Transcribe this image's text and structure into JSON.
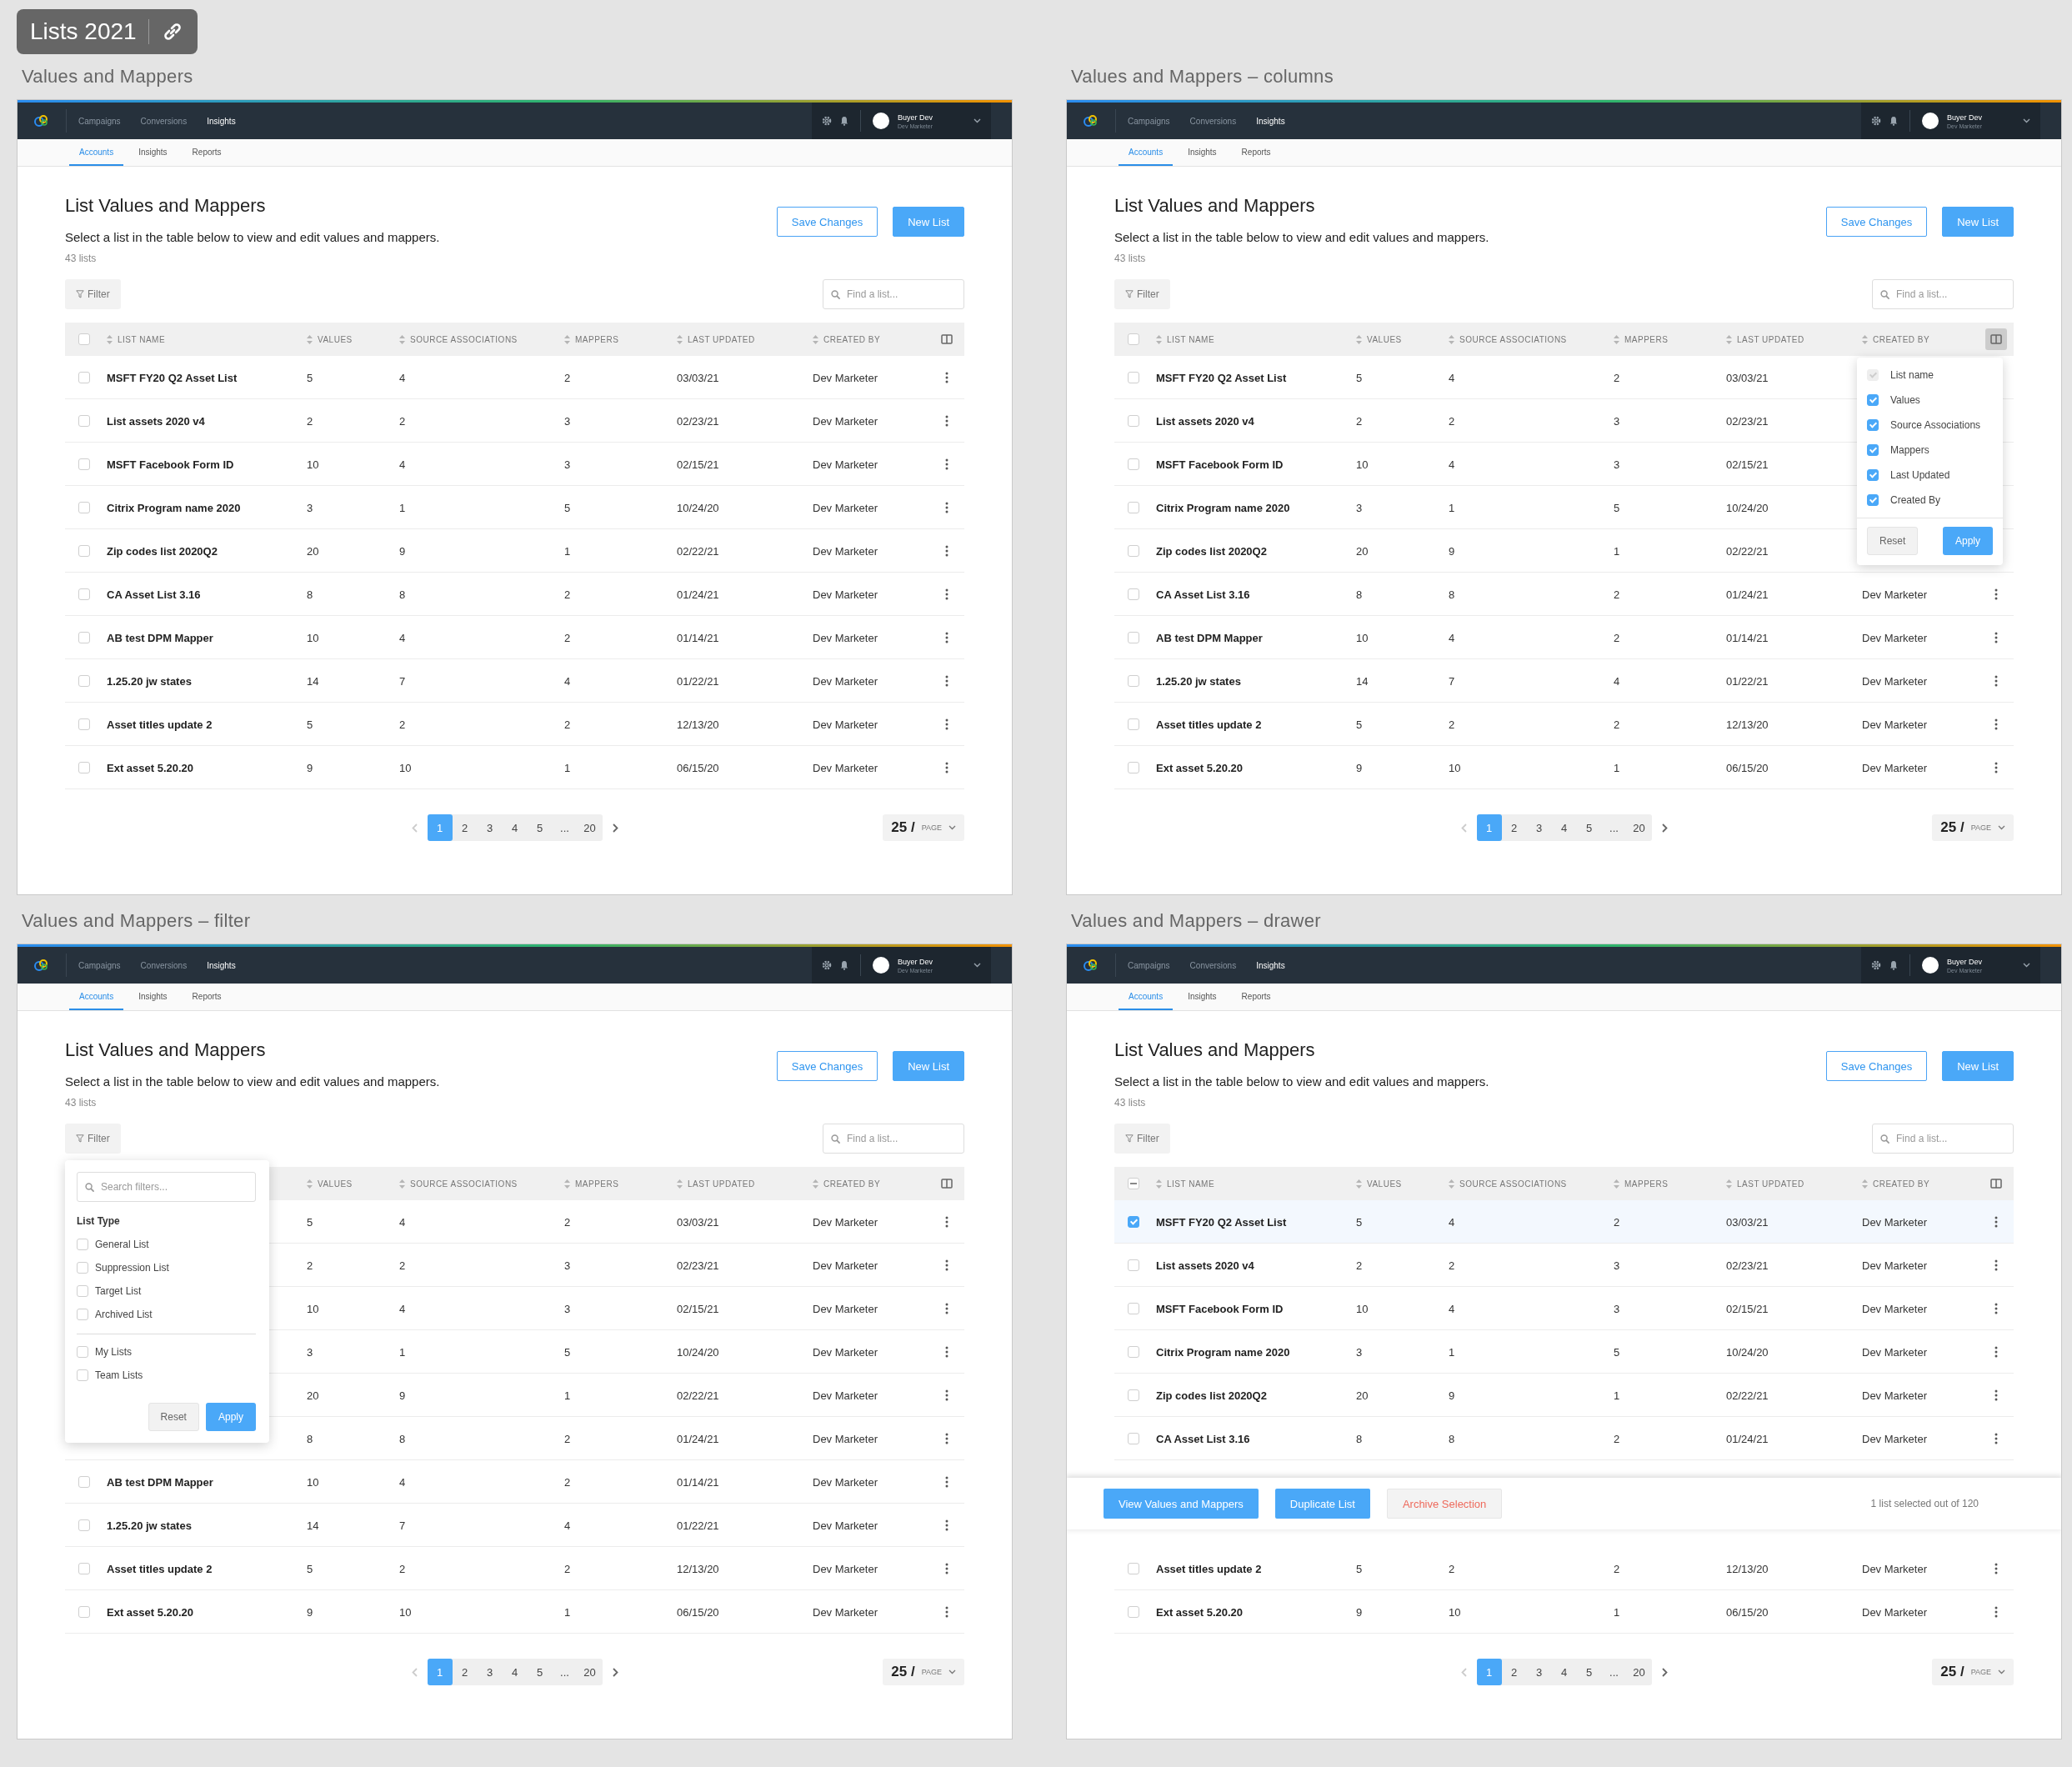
{
  "badge": {
    "title": "Lists 2021"
  },
  "artboards": [
    {
      "label": "Values and Mappers",
      "nav": {
        "items": [
          {
            "label": "Campaigns",
            "selected": false
          },
          {
            "label": "Conversions",
            "selected": false
          },
          {
            "label": "Insights",
            "selected": true
          }
        ],
        "user": {
          "name": "Buyer Dev",
          "role": "Dev Marketer"
        }
      },
      "tabs": [
        {
          "label": "Accounts",
          "selected": true
        },
        {
          "label": "Insights",
          "selected": false
        },
        {
          "label": "Reports",
          "selected": false
        }
      ],
      "page": {
        "title": "List Values and Mappers",
        "subtitle": "Select a list in the table below to view and edit values and mappers.",
        "count": "43 lists",
        "save_button": "Save Changes",
        "new_button": "New List",
        "filter_button": "Filter",
        "search_placeholder": "Find a list..."
      },
      "table": {
        "header_checkbox": {
          "indeterminate": false
        },
        "column_toggle_active": false,
        "columns": [
          "LIST NAME",
          "VALUES",
          "SOURCE ASSOCIATIONS",
          "MAPPERS",
          "LAST UPDATED",
          "CREATED BY"
        ],
        "rows": [
          {
            "selected": false,
            "name": "MSFT FY20 Q2 Asset List",
            "values": "5",
            "sources": "4",
            "mappers": "2",
            "updated": "03/03/21",
            "created_by": "Dev Marketer"
          },
          {
            "selected": false,
            "name": "List assets 2020 v4",
            "values": "2",
            "sources": "2",
            "mappers": "3",
            "updated": "02/23/21",
            "created_by": "Dev Marketer"
          },
          {
            "selected": false,
            "name": "MSFT Facebook Form ID",
            "values": "10",
            "sources": "4",
            "mappers": "3",
            "updated": "02/15/21",
            "created_by": "Dev Marketer"
          },
          {
            "selected": false,
            "name": "Citrix Program name 2020",
            "values": "3",
            "sources": "1",
            "mappers": "5",
            "updated": "10/24/20",
            "created_by": "Dev Marketer"
          },
          {
            "selected": false,
            "name": "Zip codes list 2020Q2",
            "values": "20",
            "sources": "9",
            "mappers": "1",
            "updated": "02/22/21",
            "created_by": "Dev Marketer"
          },
          {
            "selected": false,
            "name": "CA Asset List 3.16",
            "values": "8",
            "sources": "8",
            "mappers": "2",
            "updated": "01/24/21",
            "created_by": "Dev Marketer"
          },
          {
            "selected": false,
            "name": "AB test DPM Mapper",
            "values": "10",
            "sources": "4",
            "mappers": "2",
            "updated": "01/14/21",
            "created_by": "Dev Marketer"
          },
          {
            "selected": false,
            "name": "1.25.20 jw states",
            "values": "14",
            "sources": "7",
            "mappers": "4",
            "updated": "01/22/21",
            "created_by": "Dev Marketer"
          },
          {
            "selected": false,
            "name": "Asset titles update 2",
            "values": "5",
            "sources": "2",
            "mappers": "2",
            "updated": "12/13/20",
            "created_by": "Dev Marketer"
          },
          {
            "selected": false,
            "name": "Ext asset 5.20.20",
            "values": "9",
            "sources": "10",
            "mappers": "1",
            "updated": "06/15/20",
            "created_by": "Dev Marketer"
          }
        ]
      },
      "pagination": {
        "pages": [
          {
            "label": "1",
            "selected": true
          },
          {
            "label": "2",
            "selected": false
          },
          {
            "label": "3",
            "selected": false
          },
          {
            "label": "4",
            "selected": false
          },
          {
            "label": "5",
            "selected": false
          },
          {
            "label": "...",
            "selected": false
          },
          {
            "label": "20",
            "selected": false
          }
        ],
        "per_page": "25 /",
        "per_page_unit": "PAGE"
      }
    },
    {
      "label": "Values and Mappers – columns",
      "nav": {
        "items": [
          {
            "label": "Campaigns",
            "selected": false
          },
          {
            "label": "Conversions",
            "selected": false
          },
          {
            "label": "Insights",
            "selected": true
          }
        ],
        "user": {
          "name": "Buyer Dev",
          "role": "Dev Marketer"
        }
      },
      "tabs": [
        {
          "label": "Accounts",
          "selected": true
        },
        {
          "label": "Insights",
          "selected": false
        },
        {
          "label": "Reports",
          "selected": false
        }
      ],
      "page": {
        "title": "List Values and Mappers",
        "subtitle": "Select a list in the table below to view and edit values and mappers.",
        "count": "43 lists",
        "save_button": "Save Changes",
        "new_button": "New List",
        "filter_button": "Filter",
        "search_placeholder": "Find a list..."
      },
      "table": {
        "header_checkbox": {
          "indeterminate": false
        },
        "column_toggle_active": true,
        "columns": [
          "LIST NAME",
          "VALUES",
          "SOURCE ASSOCIATIONS",
          "MAPPERS",
          "LAST UPDATED",
          "CREATED BY"
        ],
        "rows": [
          {
            "selected": false,
            "name": "MSFT FY20 Q2 Asset List",
            "values": "5",
            "sources": "4",
            "mappers": "2",
            "updated": "03/03/21"
          },
          {
            "selected": false,
            "name": "List assets 2020 v4",
            "values": "2",
            "sources": "2",
            "mappers": "3",
            "updated": "02/23/21"
          },
          {
            "selected": false,
            "name": "MSFT Facebook Form ID",
            "values": "10",
            "sources": "4",
            "mappers": "3",
            "updated": "02/15/21"
          },
          {
            "selected": false,
            "name": "Citrix Program name 2020",
            "values": "3",
            "sources": "1",
            "mappers": "5",
            "updated": "10/24/20"
          },
          {
            "selected": false,
            "name": "Zip codes list 2020Q2",
            "values": "20",
            "sources": "9",
            "mappers": "1",
            "updated": "02/22/21"
          },
          {
            "selected": false,
            "name": "CA Asset List 3.16",
            "values": "8",
            "sources": "8",
            "mappers": "2",
            "updated": "01/24/21",
            "created_by": "Dev Marketer"
          },
          {
            "selected": false,
            "name": "AB test DPM Mapper",
            "values": "10",
            "sources": "4",
            "mappers": "2",
            "updated": "01/14/21",
            "created_by": "Dev Marketer"
          },
          {
            "selected": false,
            "name": "1.25.20 jw states",
            "values": "14",
            "sources": "7",
            "mappers": "4",
            "updated": "01/22/21",
            "created_by": "Dev Marketer"
          },
          {
            "selected": false,
            "name": "Asset titles update 2",
            "values": "5",
            "sources": "2",
            "mappers": "2",
            "updated": "12/13/20",
            "created_by": "Dev Marketer"
          },
          {
            "selected": false,
            "name": "Ext asset 5.20.20",
            "values": "9",
            "sources": "10",
            "mappers": "1",
            "updated": "06/15/20",
            "created_by": "Dev Marketer"
          }
        ]
      },
      "column_menu": {
        "items": [
          {
            "label": "List name",
            "checked": true,
            "disabled": true
          },
          {
            "label": "Values",
            "checked": true,
            "disabled": false
          },
          {
            "label": "Source Associations",
            "checked": true,
            "disabled": false
          },
          {
            "label": "Mappers",
            "checked": true,
            "disabled": false
          },
          {
            "label": "Last Updated",
            "checked": true,
            "disabled": false
          },
          {
            "label": "Created By",
            "checked": true,
            "disabled": false
          }
        ],
        "reset": "Reset",
        "apply": "Apply"
      },
      "pagination": {
        "pages": [
          {
            "label": "1",
            "selected": true
          },
          {
            "label": "2",
            "selected": false
          },
          {
            "label": "3",
            "selected": false
          },
          {
            "label": "4",
            "selected": false
          },
          {
            "label": "5",
            "selected": false
          },
          {
            "label": "...",
            "selected": false
          },
          {
            "label": "20",
            "selected": false
          }
        ],
        "per_page": "25 /",
        "per_page_unit": "PAGE"
      }
    },
    {
      "label": "Values and Mappers – filter",
      "nav": {
        "items": [
          {
            "label": "Campaigns",
            "selected": false
          },
          {
            "label": "Conversions",
            "selected": false
          },
          {
            "label": "Insights",
            "selected": true
          }
        ],
        "user": {
          "name": "Buyer Dev",
          "role": "Dev Marketer"
        }
      },
      "tabs": [
        {
          "label": "Accounts",
          "selected": true
        },
        {
          "label": "Insights",
          "selected": false
        },
        {
          "label": "Reports",
          "selected": false
        }
      ],
      "page": {
        "title": "List Values and Mappers",
        "subtitle": "Select a list in the table below to view and edit values and mappers.",
        "count": "43 lists",
        "save_button": "Save Changes",
        "new_button": "New List",
        "filter_button": "Filter",
        "search_placeholder": "Find a list..."
      },
      "filter_panel": {
        "search_placeholder": "Search filters...",
        "groups": [
          {
            "title": "List Type",
            "options": [
              {
                "label": "General List",
                "checked": false
              },
              {
                "label": "Suppression List",
                "checked": false
              },
              {
                "label": "Target List",
                "checked": false
              },
              {
                "label": "Archived List",
                "checked": false
              }
            ]
          },
          {
            "options": [
              {
                "label": "My Lists",
                "checked": false
              },
              {
                "label": "Team Lists",
                "checked": false
              }
            ]
          }
        ],
        "reset": "Reset",
        "apply": "Apply"
      },
      "table": {
        "column_toggle_active": false,
        "columns": [
          "VALUES",
          "SOURCE ASSOCIATIONS",
          "MAPPERS",
          "LAST UPDATED",
          "CREATED BY"
        ],
        "rows": [
          {
            "values": "5",
            "sources": "4",
            "mappers": "2",
            "updated": "03/03/21",
            "created_by": "Dev Marketer"
          },
          {
            "values": "2",
            "sources": "2",
            "mappers": "3",
            "updated": "02/23/21",
            "created_by": "Dev Marketer"
          },
          {
            "values": "10",
            "sources": "4",
            "mappers": "3",
            "updated": "02/15/21",
            "created_by": "Dev Marketer"
          },
          {
            "values": "3",
            "sources": "1",
            "mappers": "5",
            "updated": "10/24/20",
            "created_by": "Dev Marketer"
          },
          {
            "values": "20",
            "sources": "9",
            "mappers": "1",
            "updated": "02/22/21",
            "created_by": "Dev Marketer"
          },
          {
            "values": "8",
            "sources": "8",
            "mappers": "2",
            "updated": "01/24/21",
            "created_by": "Dev Marketer"
          },
          {
            "selected": false,
            "name": "AB test DPM Mapper",
            "values": "10",
            "sources": "4",
            "mappers": "2",
            "updated": "01/14/21",
            "created_by": "Dev Marketer"
          },
          {
            "selected": false,
            "name": "1.25.20 jw states",
            "values": "14",
            "sources": "7",
            "mappers": "4",
            "updated": "01/22/21",
            "created_by": "Dev Marketer"
          },
          {
            "selected": false,
            "name": "Asset titles update 2",
            "values": "5",
            "sources": "2",
            "mappers": "2",
            "updated": "12/13/20",
            "created_by": "Dev Marketer"
          },
          {
            "selected": false,
            "name": "Ext asset 5.20.20",
            "values": "9",
            "sources": "10",
            "mappers": "1",
            "updated": "06/15/20",
            "created_by": "Dev Marketer"
          }
        ]
      },
      "pagination": {
        "pages": [
          {
            "label": "1",
            "selected": true
          },
          {
            "label": "2",
            "selected": false
          },
          {
            "label": "3",
            "selected": false
          },
          {
            "label": "4",
            "selected": false
          },
          {
            "label": "5",
            "selected": false
          },
          {
            "label": "...",
            "selected": false
          },
          {
            "label": "20",
            "selected": false
          }
        ],
        "per_page": "25 /",
        "per_page_unit": "PAGE"
      }
    },
    {
      "label": "Values and Mappers – drawer",
      "nav": {
        "items": [
          {
            "label": "Campaigns",
            "selected": false
          },
          {
            "label": "Conversions",
            "selected": false
          },
          {
            "label": "Insights",
            "selected": true
          }
        ],
        "user": {
          "name": "Buyer Dev",
          "role": "Dev Marketer"
        }
      },
      "tabs": [
        {
          "label": "Accounts",
          "selected": true
        },
        {
          "label": "Insights",
          "selected": false
        },
        {
          "label": "Reports",
          "selected": false
        }
      ],
      "page": {
        "title": "List Values and Mappers",
        "subtitle": "Select a list in the table below to view and edit values and mappers.",
        "count": "43 lists",
        "save_button": "Save Changes",
        "new_button": "New List",
        "filter_button": "Filter",
        "search_placeholder": "Find a list..."
      },
      "table": {
        "header_checkbox": {
          "indeterminate": true
        },
        "column_toggle_active": false,
        "columns": [
          "LIST NAME",
          "VALUES",
          "SOURCE ASSOCIATIONS",
          "MAPPERS",
          "LAST UPDATED",
          "CREATED BY"
        ],
        "rows": [
          {
            "selected": true,
            "name": "MSFT FY20 Q2 Asset List",
            "values": "5",
            "sources": "4",
            "mappers": "2",
            "updated": "03/03/21",
            "created_by": "Dev Marketer"
          },
          {
            "selected": false,
            "name": "List assets 2020 v4",
            "values": "2",
            "sources": "2",
            "mappers": "3",
            "updated": "02/23/21",
            "created_by": "Dev Marketer"
          },
          {
            "selected": false,
            "name": "MSFT Facebook Form ID",
            "values": "10",
            "sources": "4",
            "mappers": "3",
            "updated": "02/15/21",
            "created_by": "Dev Marketer"
          },
          {
            "selected": false,
            "name": "Citrix Program name 2020",
            "values": "3",
            "sources": "1",
            "mappers": "5",
            "updated": "10/24/20",
            "created_by": "Dev Marketer"
          },
          {
            "selected": false,
            "name": "Zip codes list 2020Q2",
            "values": "20",
            "sources": "9",
            "mappers": "1",
            "updated": "02/22/21",
            "created_by": "Dev Marketer"
          },
          {
            "selected": false,
            "name": "CA Asset List 3.16",
            "values": "8",
            "sources": "8",
            "mappers": "2",
            "updated": "01/24/21",
            "created_by": "Dev Marketer"
          }
        ],
        "rows_below": [
          {
            "selected": false,
            "name": "Asset titles update 2",
            "values": "5",
            "sources": "2",
            "mappers": "2",
            "updated": "12/13/20",
            "created_by": "Dev Marketer"
          },
          {
            "selected": false,
            "name": "Ext asset 5.20.20",
            "values": "9",
            "sources": "10",
            "mappers": "1",
            "updated": "06/15/20",
            "created_by": "Dev Marketer"
          }
        ]
      },
      "action_bar": {
        "buttons": [
          {
            "label": "View Values and Mappers",
            "kind": "primary"
          },
          {
            "label": "Duplicate List",
            "kind": "primary"
          },
          {
            "label": "Archive Selection",
            "kind": "danger"
          }
        ],
        "status": "1 list selected out of 120"
      },
      "pagination": {
        "pages": [
          {
            "label": "1",
            "selected": true
          },
          {
            "label": "2",
            "selected": false
          },
          {
            "label": "3",
            "selected": false
          },
          {
            "label": "4",
            "selected": false
          },
          {
            "label": "5",
            "selected": false
          },
          {
            "label": "...",
            "selected": false
          },
          {
            "label": "20",
            "selected": false
          }
        ],
        "per_page": "25 /",
        "per_page_unit": "PAGE"
      }
    }
  ]
}
